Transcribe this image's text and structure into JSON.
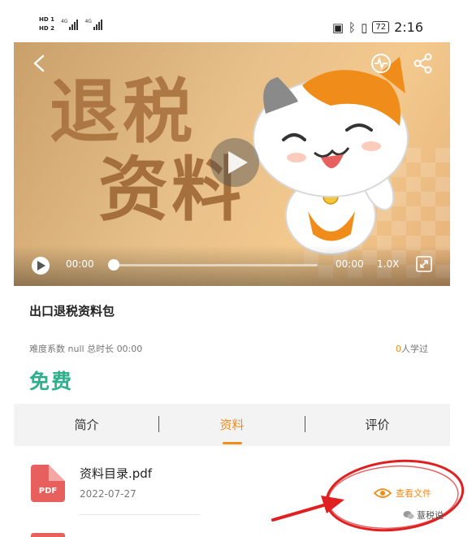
{
  "status_bar": {
    "hd1": "HD 1",
    "hd2": "HD 2",
    "signal1": "4G",
    "signal2": "4G",
    "battery": "72",
    "time": "2:16"
  },
  "video": {
    "title_line1": "退税",
    "title_line2": "资料",
    "current_time": "00:00",
    "duration": "00:00",
    "speed": "1.0X",
    "progress": 0
  },
  "course": {
    "title": "出口退税资料包",
    "difficulty_label": "难度系数",
    "difficulty_value": "null",
    "duration_label": "总时长",
    "duration_value": "00:00",
    "learners_count": "0",
    "learners_label": "人学过",
    "price": "免费"
  },
  "tabs": [
    {
      "label": "简介",
      "active": false
    },
    {
      "label": "资料",
      "active": true
    },
    {
      "label": "评价",
      "active": false
    }
  ],
  "files": [
    {
      "icon_text": "PDF",
      "name": "资料目录.pdf",
      "date": "2022-07-27",
      "action": "查看文件"
    }
  ],
  "watermark": "薏税说",
  "colors": {
    "accent": "#f08c1a",
    "price": "#2db08e",
    "pdf": "#e8605d",
    "annotation": "#e02020"
  }
}
